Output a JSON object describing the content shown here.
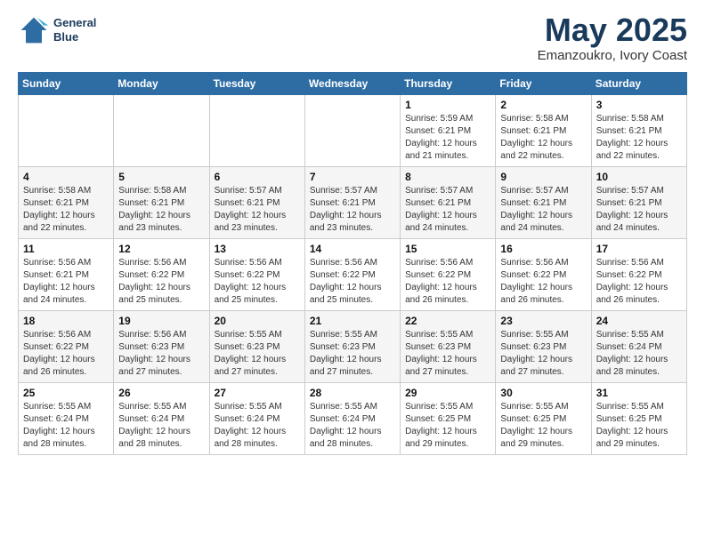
{
  "header": {
    "logo_line1": "General",
    "logo_line2": "Blue",
    "month_title": "May 2025",
    "location": "Emanzoukro, Ivory Coast"
  },
  "days_of_week": [
    "Sunday",
    "Monday",
    "Tuesday",
    "Wednesday",
    "Thursday",
    "Friday",
    "Saturday"
  ],
  "weeks": [
    [
      {
        "day": "",
        "info": ""
      },
      {
        "day": "",
        "info": ""
      },
      {
        "day": "",
        "info": ""
      },
      {
        "day": "",
        "info": ""
      },
      {
        "day": "1",
        "info": "Sunrise: 5:59 AM\nSunset: 6:21 PM\nDaylight: 12 hours\nand 21 minutes."
      },
      {
        "day": "2",
        "info": "Sunrise: 5:58 AM\nSunset: 6:21 PM\nDaylight: 12 hours\nand 22 minutes."
      },
      {
        "day": "3",
        "info": "Sunrise: 5:58 AM\nSunset: 6:21 PM\nDaylight: 12 hours\nand 22 minutes."
      }
    ],
    [
      {
        "day": "4",
        "info": "Sunrise: 5:58 AM\nSunset: 6:21 PM\nDaylight: 12 hours\nand 22 minutes."
      },
      {
        "day": "5",
        "info": "Sunrise: 5:58 AM\nSunset: 6:21 PM\nDaylight: 12 hours\nand 23 minutes."
      },
      {
        "day": "6",
        "info": "Sunrise: 5:57 AM\nSunset: 6:21 PM\nDaylight: 12 hours\nand 23 minutes."
      },
      {
        "day": "7",
        "info": "Sunrise: 5:57 AM\nSunset: 6:21 PM\nDaylight: 12 hours\nand 23 minutes."
      },
      {
        "day": "8",
        "info": "Sunrise: 5:57 AM\nSunset: 6:21 PM\nDaylight: 12 hours\nand 24 minutes."
      },
      {
        "day": "9",
        "info": "Sunrise: 5:57 AM\nSunset: 6:21 PM\nDaylight: 12 hours\nand 24 minutes."
      },
      {
        "day": "10",
        "info": "Sunrise: 5:57 AM\nSunset: 6:21 PM\nDaylight: 12 hours\nand 24 minutes."
      }
    ],
    [
      {
        "day": "11",
        "info": "Sunrise: 5:56 AM\nSunset: 6:21 PM\nDaylight: 12 hours\nand 24 minutes."
      },
      {
        "day": "12",
        "info": "Sunrise: 5:56 AM\nSunset: 6:22 PM\nDaylight: 12 hours\nand 25 minutes."
      },
      {
        "day": "13",
        "info": "Sunrise: 5:56 AM\nSunset: 6:22 PM\nDaylight: 12 hours\nand 25 minutes."
      },
      {
        "day": "14",
        "info": "Sunrise: 5:56 AM\nSunset: 6:22 PM\nDaylight: 12 hours\nand 25 minutes."
      },
      {
        "day": "15",
        "info": "Sunrise: 5:56 AM\nSunset: 6:22 PM\nDaylight: 12 hours\nand 26 minutes."
      },
      {
        "day": "16",
        "info": "Sunrise: 5:56 AM\nSunset: 6:22 PM\nDaylight: 12 hours\nand 26 minutes."
      },
      {
        "day": "17",
        "info": "Sunrise: 5:56 AM\nSunset: 6:22 PM\nDaylight: 12 hours\nand 26 minutes."
      }
    ],
    [
      {
        "day": "18",
        "info": "Sunrise: 5:56 AM\nSunset: 6:22 PM\nDaylight: 12 hours\nand 26 minutes."
      },
      {
        "day": "19",
        "info": "Sunrise: 5:56 AM\nSunset: 6:23 PM\nDaylight: 12 hours\nand 27 minutes."
      },
      {
        "day": "20",
        "info": "Sunrise: 5:55 AM\nSunset: 6:23 PM\nDaylight: 12 hours\nand 27 minutes."
      },
      {
        "day": "21",
        "info": "Sunrise: 5:55 AM\nSunset: 6:23 PM\nDaylight: 12 hours\nand 27 minutes."
      },
      {
        "day": "22",
        "info": "Sunrise: 5:55 AM\nSunset: 6:23 PM\nDaylight: 12 hours\nand 27 minutes."
      },
      {
        "day": "23",
        "info": "Sunrise: 5:55 AM\nSunset: 6:23 PM\nDaylight: 12 hours\nand 27 minutes."
      },
      {
        "day": "24",
        "info": "Sunrise: 5:55 AM\nSunset: 6:24 PM\nDaylight: 12 hours\nand 28 minutes."
      }
    ],
    [
      {
        "day": "25",
        "info": "Sunrise: 5:55 AM\nSunset: 6:24 PM\nDaylight: 12 hours\nand 28 minutes."
      },
      {
        "day": "26",
        "info": "Sunrise: 5:55 AM\nSunset: 6:24 PM\nDaylight: 12 hours\nand 28 minutes."
      },
      {
        "day": "27",
        "info": "Sunrise: 5:55 AM\nSunset: 6:24 PM\nDaylight: 12 hours\nand 28 minutes."
      },
      {
        "day": "28",
        "info": "Sunrise: 5:55 AM\nSunset: 6:24 PM\nDaylight: 12 hours\nand 28 minutes."
      },
      {
        "day": "29",
        "info": "Sunrise: 5:55 AM\nSunset: 6:25 PM\nDaylight: 12 hours\nand 29 minutes."
      },
      {
        "day": "30",
        "info": "Sunrise: 5:55 AM\nSunset: 6:25 PM\nDaylight: 12 hours\nand 29 minutes."
      },
      {
        "day": "31",
        "info": "Sunrise: 5:55 AM\nSunset: 6:25 PM\nDaylight: 12 hours\nand 29 minutes."
      }
    ]
  ]
}
